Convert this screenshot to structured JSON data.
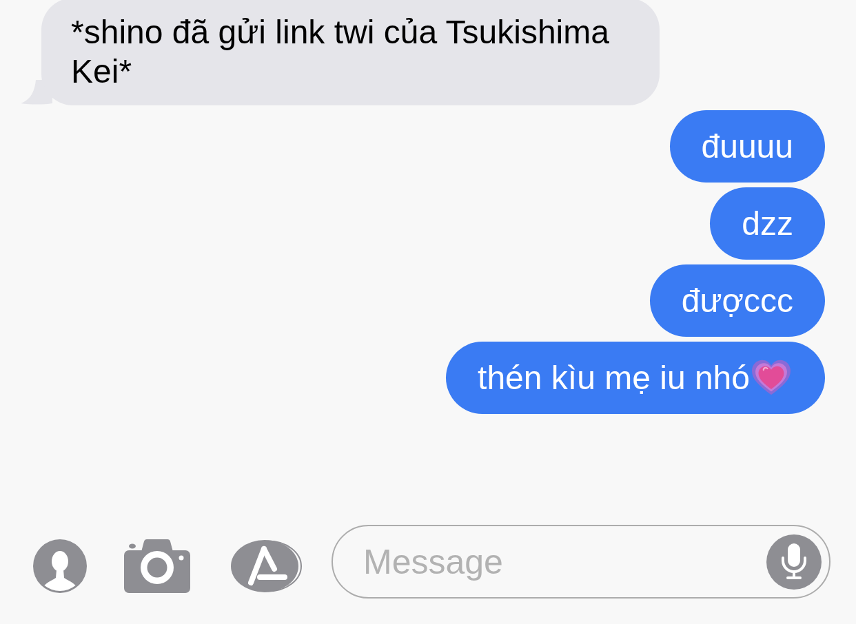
{
  "messages": [
    {
      "kind": "received",
      "text": "*shino đã gửi link twi của Tsukishima Kei*",
      "emoji": false
    },
    {
      "kind": "sent",
      "text": "đuuuu",
      "emoji": false
    },
    {
      "kind": "sent",
      "text": "dzz",
      "emoji": false
    },
    {
      "kind": "sent",
      "text": "đượccc",
      "emoji": false
    },
    {
      "kind": "sent",
      "text": "thén kìu mẹ iu nhó",
      "emoji": true
    }
  ],
  "composer": {
    "placeholder": "Message"
  }
}
